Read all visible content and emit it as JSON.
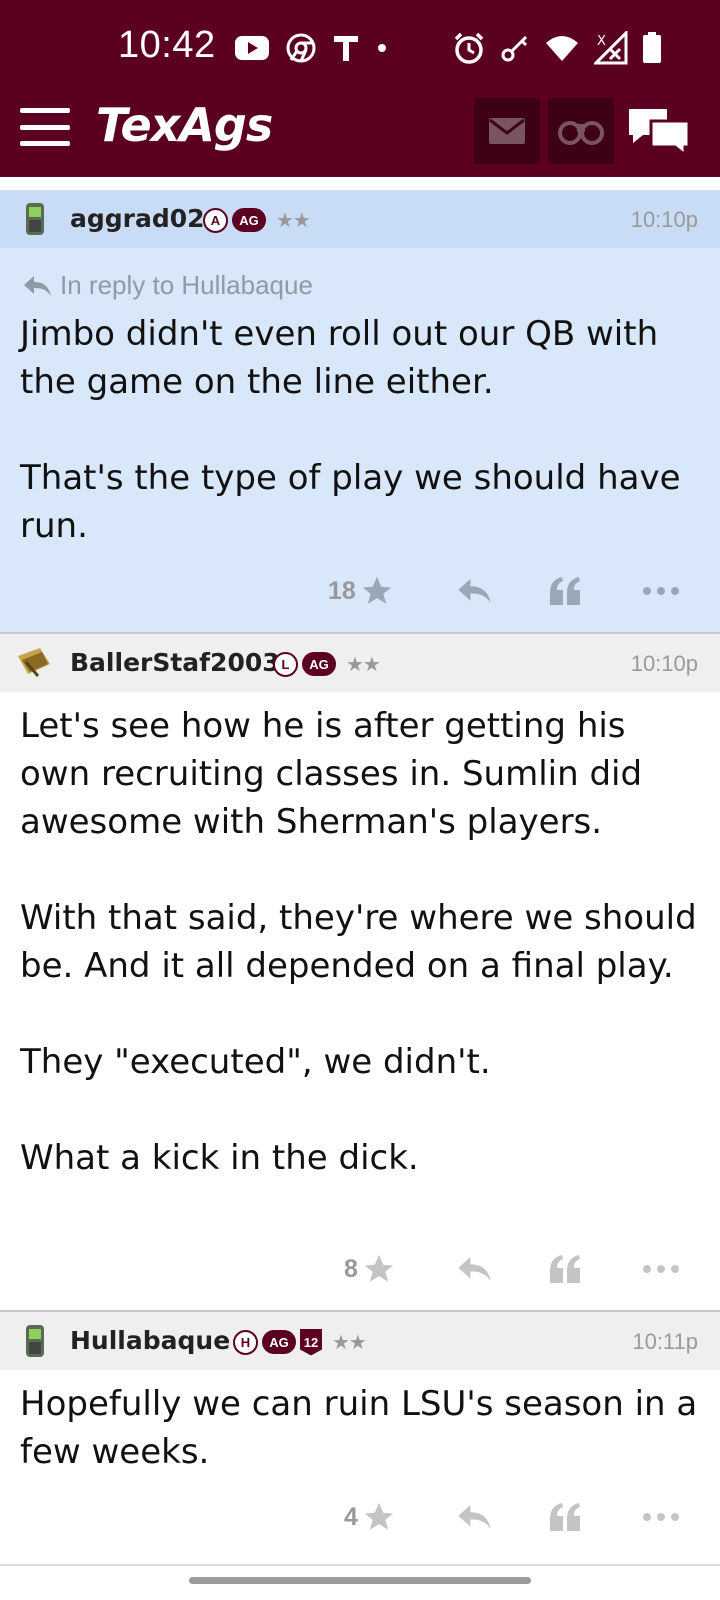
{
  "status_bar": {
    "time": "10:42",
    "left_icons": [
      "youtube-icon",
      "chrome-icon",
      "t-mobile-icon",
      "dot-icon"
    ],
    "right_icons": [
      "alarm-icon",
      "key-icon",
      "wifi-icon",
      "no-signal-icon",
      "battery-icon"
    ]
  },
  "app_bar": {
    "logo": "TexAgs",
    "buttons": [
      "mail-icon",
      "binoculars-icon",
      "chat-icon"
    ]
  },
  "colors": {
    "brand": "#5c0022",
    "brand_dark": "#3d0016",
    "highlight_post_bg": "#d8e7fa",
    "highlight_header_bg": "#c9dcf6",
    "header_bg": "#efefef",
    "muted": "#9a9a9a"
  },
  "posts": [
    {
      "username": "aggrad02",
      "badges": [
        "A",
        "AG"
      ],
      "stars": "★★",
      "time": "10:10p",
      "reply_to": "In reply to Hullabaque",
      "body": "Jimbo didn't even roll out our QB with the game on the line either.\n\nThat's the type of play we should have run.",
      "star_count": "18",
      "avatar": "phone-avatar-icon"
    },
    {
      "username": "BallerStaf2003",
      "badges": [
        "L",
        "AG"
      ],
      "stars": "★★",
      "time": "10:10p",
      "body": "Let's see how he is after getting his own recruiting classes in. Sumlin did awesome with Sherman's players.\n\nWith that said, they're where we should be. And it all depended on a final play.\n\nThey \"executed\", we didn't.\n\nWhat a kick in the dick.",
      "star_count": "8",
      "avatar": "money-avatar-icon"
    },
    {
      "username": "Hullabaque",
      "badges": [
        "H",
        "AG",
        "12"
      ],
      "stars": "★★",
      "time": "10:11p",
      "body": "Hopefully we can ruin LSU's season in a few weeks.",
      "star_count": "4",
      "avatar": "phone-avatar-icon"
    }
  ]
}
